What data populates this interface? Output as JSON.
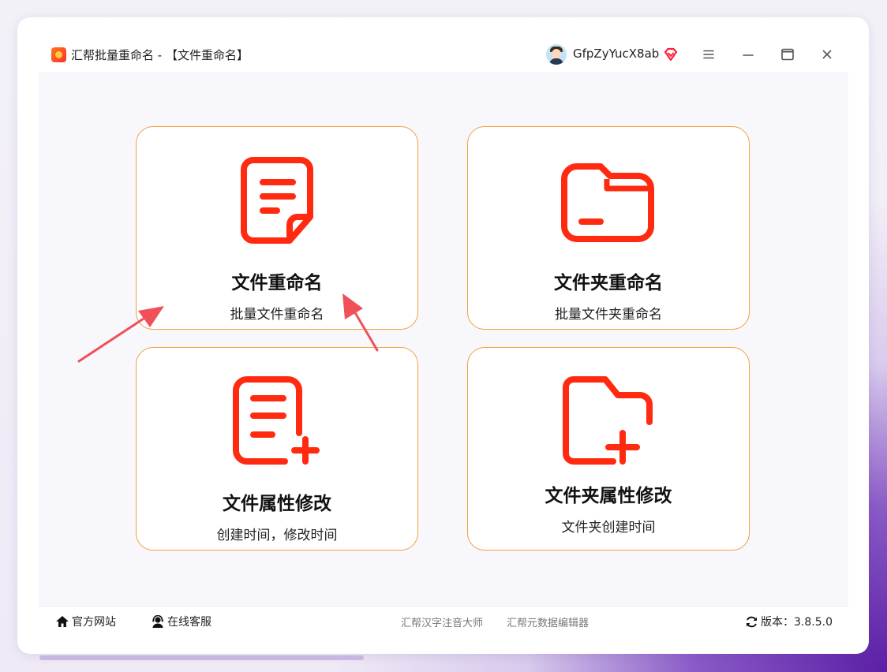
{
  "window": {
    "title": "汇帮批量重命名 - 【文件重命名】",
    "username": "GfpZyYucX8ab",
    "icons": {
      "app": "app-logo-icon",
      "avatar": "avatar-icon",
      "vip": "vip-diamond-icon",
      "menu": "menu-icon",
      "minimize": "minimize-icon",
      "maximize": "maximize-icon",
      "close": "close-icon"
    }
  },
  "cards": [
    {
      "title": "文件重命名",
      "subtitle": "批量文件重命名",
      "icon": "document-icon"
    },
    {
      "title": "文件夹重命名",
      "subtitle": "批量文件夹重命名",
      "icon": "folder-icon"
    },
    {
      "title": "文件属性修改",
      "subtitle": "创建时间，修改时间",
      "icon": "document-add-icon"
    },
    {
      "title": "文件夹属性修改",
      "subtitle": "文件夹创建时间",
      "icon": "folder-add-icon"
    }
  ],
  "footer": {
    "website": "官方网站",
    "support": "在线客服",
    "link1": "汇帮汉字注音大师",
    "link2": "汇帮元数据编辑器",
    "version": "版本：3.8.5.0"
  },
  "colors": {
    "accent": "#ff2a10",
    "card_border": "#f0a040",
    "annotation_arrow": "#f0505a"
  }
}
